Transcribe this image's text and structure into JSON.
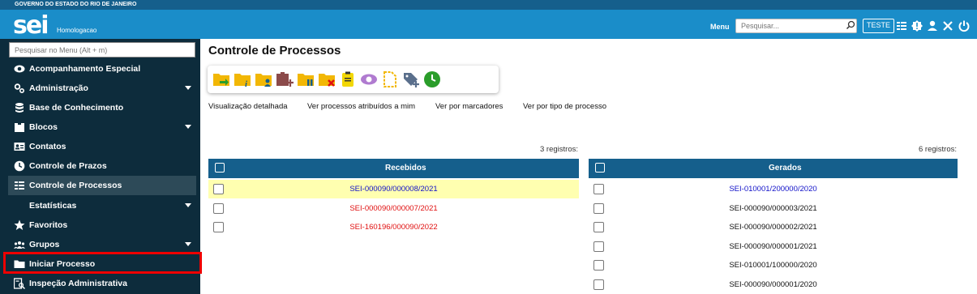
{
  "header": {
    "gov_label": "GOVERNO DO ESTADO DO RIO DE JANEIRO",
    "logo": "sei",
    "environment": "Homologacao",
    "menu_label": "Menu",
    "search_placeholder": "Pesquisar...",
    "unit_label": "TESTE",
    "icons": [
      "unit-list-icon",
      "notification-icon",
      "user-icon",
      "settings-icon",
      "power-icon"
    ]
  },
  "sidebar": {
    "search_placeholder": "Pesquisar no Menu (Alt + m)",
    "items": [
      {
        "label": "Acompanhamento Especial",
        "icon": "eye-icon"
      },
      {
        "label": "Administração",
        "icon": "gears-icon",
        "expandable": true
      },
      {
        "label": "Base de Conhecimento",
        "icon": "database-icon"
      },
      {
        "label": "Blocos",
        "icon": "briefcase-icon",
        "expandable": true
      },
      {
        "label": "Contatos",
        "icon": "contact-card-icon"
      },
      {
        "label": "Controle de Prazos",
        "icon": "clock-icon"
      },
      {
        "label": "Controle de Processos",
        "icon": "process-list-icon",
        "active": true
      },
      {
        "label": "Estatísticas",
        "icon": "",
        "expandable": true
      },
      {
        "label": "Favoritos",
        "icon": "star-icon"
      },
      {
        "label": "Grupos",
        "icon": "group-icon",
        "expandable": true
      },
      {
        "label": "Iniciar Processo",
        "icon": "folder-icon",
        "highlighted": true
      },
      {
        "label": "Inspeção Administrativa",
        "icon": "inspection-icon"
      }
    ]
  },
  "main": {
    "title": "Controle de Processos",
    "toolbar_icons": [
      "send-process-icon",
      "process-info-icon",
      "assign-process-icon",
      "add-to-block-icon",
      "pause-process-icon",
      "remove-process-icon",
      "annotation-icon",
      "view-icon",
      "new-document-icon",
      "tag-add-icon",
      "control-deadline-icon"
    ],
    "view_links": [
      "Visualização detalhada",
      "Ver processos atribuídos a mim",
      "Ver por marcadores",
      "Ver por tipo de processo"
    ],
    "recebidos": {
      "header": "Recebidos",
      "count": "3 registros:",
      "rows": [
        {
          "process": "SEI-000090/000008/2021",
          "color": "#1010c8",
          "highlight": true
        },
        {
          "process": "SEI-000090/000007/2021",
          "color": "#e01010",
          "highlight": false
        },
        {
          "process": "SEI-160196/000090/2022",
          "color": "#e01010",
          "highlight": false
        }
      ]
    },
    "gerados": {
      "header": "Gerados",
      "count": "6 registros:",
      "rows": [
        {
          "process": "SEI-010001/200000/2020",
          "color": "#1010c8"
        },
        {
          "process": "SEI-000090/000003/2021",
          "color": "#111111"
        },
        {
          "process": "SEI-000090/000002/2021",
          "color": "#111111"
        },
        {
          "process": "SEI-000090/000001/2021",
          "color": "#111111"
        },
        {
          "process": "SEI-010001/100000/2020",
          "color": "#111111"
        },
        {
          "process": "SEI-000090/000001/2020",
          "color": "#111111"
        }
      ]
    }
  }
}
